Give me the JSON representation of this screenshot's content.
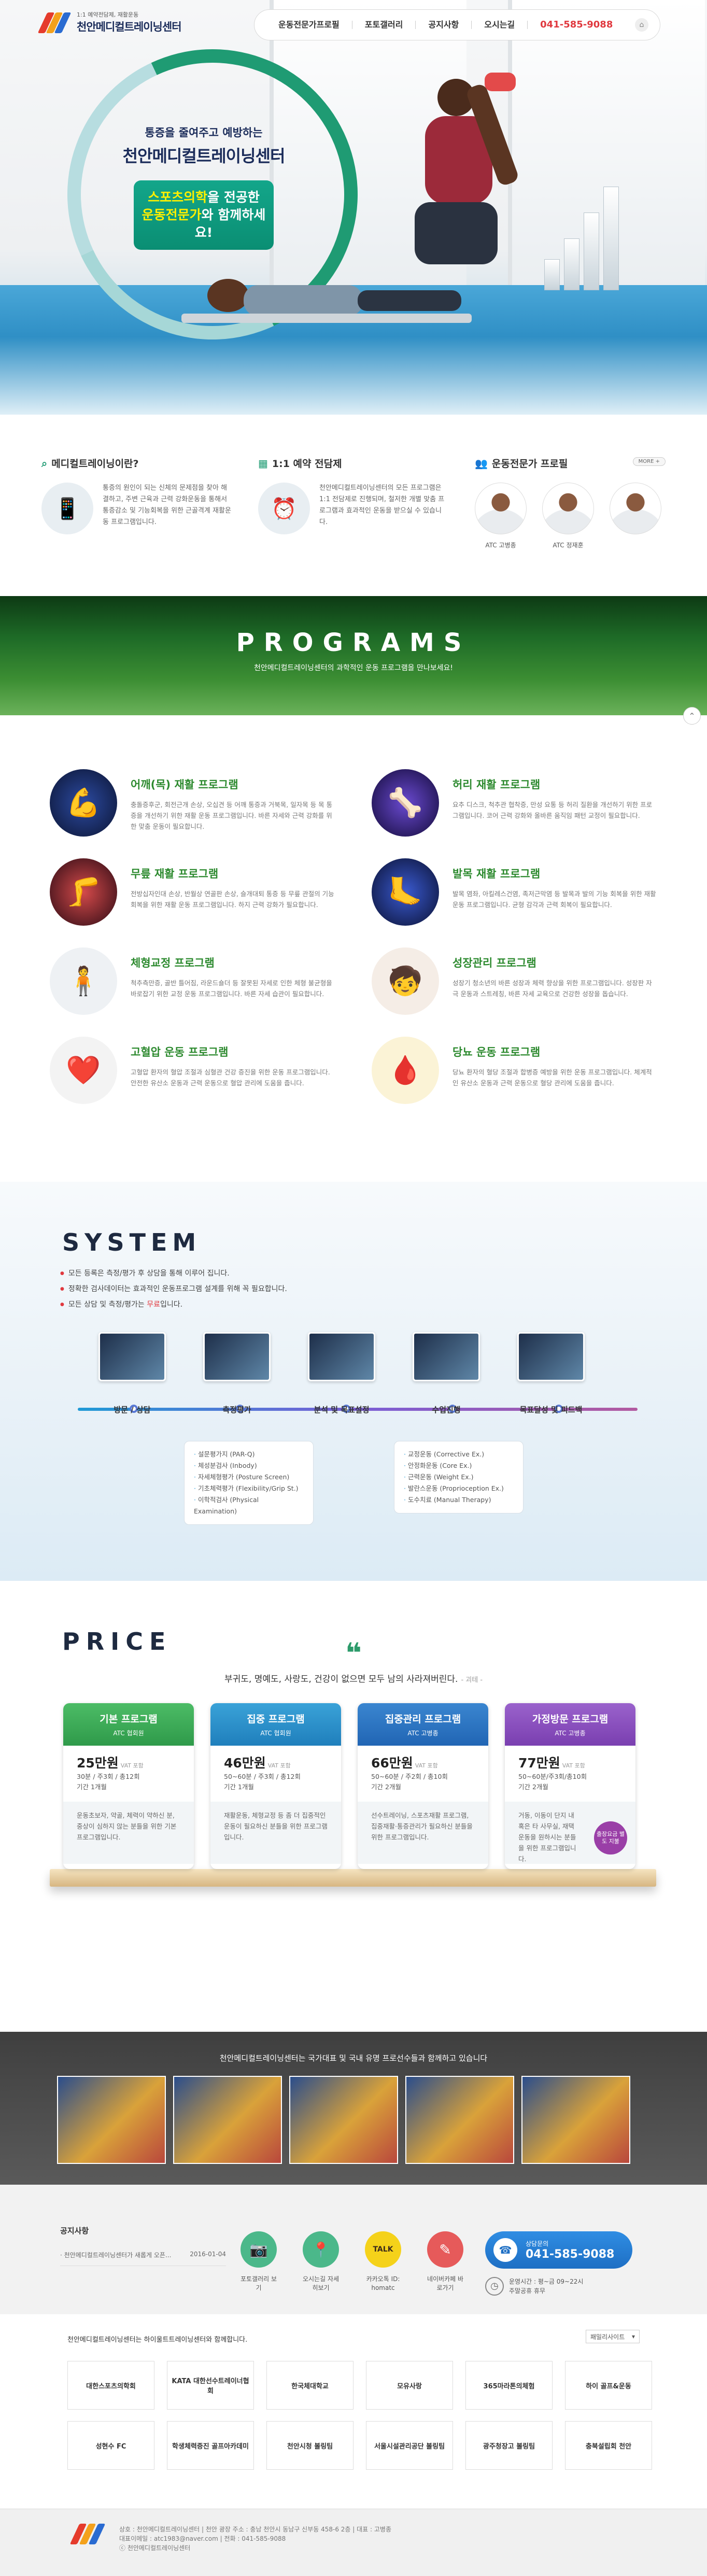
{
  "header": {
    "logo_sub": "1:1 예약전담제, 재활운동",
    "logo_title": "천안메디컬트레이닝센터",
    "nav": [
      "운동전문가프로필",
      "포토갤러리",
      "공지사항",
      "오시는길"
    ],
    "phone": "041-585-9088",
    "home_icon": "home-icon"
  },
  "hero": {
    "line1": "통증을 줄여주고 예방하는",
    "line2": "천안메디컬트레이닝센터",
    "box_line1a": "스포츠의학",
    "box_line1b": "을 전공한",
    "box_line2a": "운동전문가",
    "box_line2b": "와 함께하세요!"
  },
  "info": {
    "about": {
      "title": "메디컬트레이닝이란?",
      "text": "통증의 원인이 되는 신체의 문제점을 찾아 해결하고, 주변 근육과 근력 강화운동을 통해서 통증감소 및 기능회복을 위한 근골격계 재활운동 프로그램입니다."
    },
    "reservation": {
      "title": "1:1 예약 전담제",
      "text": "천안메디컬트레이닝센터의 모든 프로그램은 1:1 전담제로 진행되며, 철저한 개별 맞춤 프로그램과 효과적인 운동을 받으실 수 있습니다."
    },
    "experts": {
      "title": "운동전문가 프로필",
      "more": "MORE +",
      "list": [
        "ATC 고병종",
        "ATC 정재훈"
      ]
    }
  },
  "programs": {
    "title": "PROGRAMS",
    "subtitle": "천안메디컬트레이닝센터의 과학적인 운동 프로그램을 만나보세요!",
    "items": [
      {
        "icon": "shoulder-icon",
        "title": "어깨(목) 재활 프로그램",
        "text": "충돌증후군, 회전근개 손상, 오십견 등 어깨 통증과 거북목, 일자목 등 목 통증을 개선하기 위한 재활 운동 프로그램입니다. 바른 자세와 근력 강화를 위한 맞춤 운동이 필요합니다."
      },
      {
        "icon": "back-icon",
        "title": "허리 재활 프로그램",
        "text": "요추 디스크, 척추관 협착증, 만성 요통 등 허리 질환을 개선하기 위한 프로그램입니다. 코어 근력 강화와 올바른 움직임 패턴 교정이 필요합니다."
      },
      {
        "icon": "knee-icon",
        "title": "무릎 재활 프로그램",
        "text": "전방십자인대 손상, 반월상 연골판 손상, 슬개대퇴 통증 등 무릎 관절의 기능 회복을 위한 재활 운동 프로그램입니다. 하지 근력 강화가 필요합니다."
      },
      {
        "icon": "ankle-icon",
        "title": "발목 재활 프로그램",
        "text": "발목 염좌, 아킬레스건염, 족저근막염 등 발목과 발의 기능 회복을 위한 재활 운동 프로그램입니다. 균형 감각과 근력 회복이 필요합니다."
      },
      {
        "icon": "posture-icon",
        "title": "체형교정 프로그램",
        "text": "척추측만증, 골반 틀어짐, 라운드숄더 등 잘못된 자세로 인한 체형 불균형을 바로잡기 위한 교정 운동 프로그램입니다. 바른 자세 습관이 필요합니다."
      },
      {
        "icon": "growth-icon",
        "title": "성장관리 프로그램",
        "text": "성장기 청소년의 바른 성장과 체력 향상을 위한 프로그램입니다. 성장판 자극 운동과 스트레칭, 바른 자세 교육으로 건강한 성장을 돕습니다."
      },
      {
        "icon": "heart-icon",
        "title": "고혈압 운동 프로그램",
        "text": "고혈압 환자의 혈압 조절과 심혈관 건강 증진을 위한 운동 프로그램입니다. 안전한 유산소 운동과 근력 운동으로 혈압 관리에 도움을 줍니다."
      },
      {
        "icon": "diabetes-icon",
        "title": "당뇨 운동 프로그램",
        "text": "당뇨 환자의 혈당 조절과 합병증 예방을 위한 운동 프로그램입니다. 체계적인 유산소 운동과 근력 운동으로 혈당 관리에 도움을 줍니다."
      }
    ]
  },
  "system": {
    "title": "SYSTEM",
    "bullets": [
      "모든 등록은 측정/평가 후 상담을 통해 이루어 집니다.",
      "정확한 검사데이터는 효과적인 운동프로그램 설계를 위해 꼭 필요합니다."
    ],
    "bullet3a": "모든 상담 및 측정/평가는 ",
    "bullet3b": "무료",
    "bullet3c": "입니다.",
    "steps": [
      "방문 / 상담",
      "측정평가",
      "분석 및 목표설정",
      "수업진행",
      "목표달성 및 피드백"
    ],
    "measure_list": [
      "설문평가지 (PAR-Q)",
      "체성분검사 (Inbody)",
      "자세체형평가 (Posture Screen)",
      "기초체력평가 (Flexibility/Grip St.)",
      "이학적검사 (Physical Examination)"
    ],
    "class_list": [
      "교정운동 (Corrective Ex.)",
      "안정화운동 (Core Ex.)",
      "근력운동 (Weight Ex.)",
      "발란스운동 (Proprioception Ex.)",
      "도수치료 (Manual Therapy)"
    ]
  },
  "price": {
    "title": "PRICE",
    "quote": "부귀도, 명예도, 사랑도, 건강이 없으면 모두 남의 사라져버린다.",
    "quote_author": "- 괴테 -",
    "cards": [
      {
        "title": "기본 프로그램",
        "sub": "ATC 협회원",
        "amount": "25만원",
        "vat": "VAT 포함",
        "line1": "30분 / 주3회 / 총12회",
        "line2": "기간 1개월",
        "desc": "운동초보자, 약골, 체력이 약하신 분, 중상이 심하지 않는 분들을 위한 기본 프로그램입니다.",
        "color": "#3fae5a"
      },
      {
        "title": "집중 프로그램",
        "sub": "ATC 협회원",
        "amount": "46만원",
        "vat": "VAT 포함",
        "line1": "50~60분 / 주3회 / 총12회",
        "line2": "기간 1개월",
        "desc": "재활운동, 체형교정 등 좀 더 집중적인 운동이 필요하신 분들을 위한 프로그램입니다.",
        "color": "#2d8dc8"
      },
      {
        "title": "집중관리 프로그램",
        "sub": "ATC 고병종",
        "amount": "66만원",
        "vat": "VAT 포함",
        "line1": "50~60분 / 주2회 / 총10회",
        "line2": "기간 2개월",
        "desc": "선수트레이닝, 스포츠재활 프로그램, 집중재활·통증관리가 필요하신 분들을 위한 프로그램입니다.",
        "color": "#2f74c4"
      },
      {
        "title": "가정방문 프로그램",
        "sub": "ATC 고병종",
        "amount": "77만원",
        "vat": "VAT 포함",
        "line1": "50~60분/주3회/총10회",
        "line2": "기간 2개월",
        "desc": "거동, 이동이 단지 내 혹은 타 사무실, 재택 운동을 원하시는 분들을 위한 프로그램입니다.",
        "color": "#8e4fc1",
        "badge": "출장요금 별도 지불"
      }
    ]
  },
  "partners": {
    "text": "천안메디컬트레이닝센터는 국가대표 및 국내 유명 프로선수들과 함께하고 있습니다"
  },
  "contact": {
    "notice_title": "공지사항",
    "notice_item": "· 천안메디컬트레이닝센터가 새롭게 오픈...",
    "notice_date": "2016-01-04",
    "quick": [
      {
        "icon": "camera-icon",
        "label": "포토갤러리 보기",
        "color": "#4bb88a"
      },
      {
        "icon": "map-pin-icon",
        "label": "오시는길 자세히보기",
        "color": "#4bb88a"
      },
      {
        "icon": "kakao-icon",
        "label": "카카오톡 ID: homatc",
        "color": "#f5d21a"
      },
      {
        "icon": "blog-icon",
        "label": "네이버카페 바로가기",
        "color": "#e65a5a"
      }
    ],
    "call_label": "상담문의",
    "call_number": "041-585-9088",
    "hours1": "운영시간 : 평~금 09~22시",
    "hours2": "주말공휴 휴무"
  },
  "family": {
    "head": "천안메디컬트레이닝센터는 하이울트트레이닝센터와 함께합니다.",
    "select": "패밀리사이트",
    "sites": [
      "대한스포츠의학회",
      "KATA 대한선수트레이너협회",
      "한국체대학교",
      "모유사랑",
      "365마라톤의체험",
      "하이 골프&운동",
      "성현수 FC",
      "학생체력증진 골프아카데미",
      "천안시청 볼링팀",
      "서울시설관리공단 볼링팀",
      "광주청장고 볼링팀",
      "충북설립회 천안"
    ]
  },
  "footer": {
    "line1": "상호 : 천안메디컬트레이닝센터  |  천안 광장 주소 : 충남 천안시 동남구 신부동 458-6 2층  |  대표 : 고병종",
    "line2": "대표이메일 : atc1983@naver.com  |  전화 : 041-585-9088",
    "line3": "ⓒ 천안메디컬트레이닝센터"
  }
}
